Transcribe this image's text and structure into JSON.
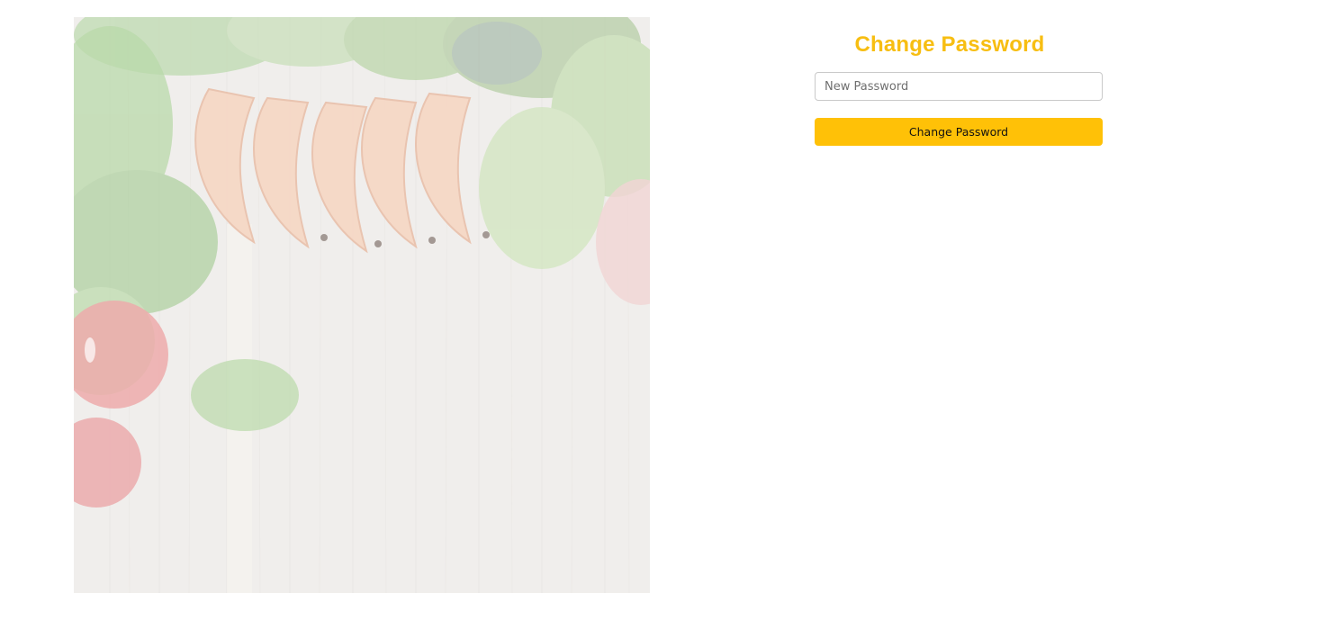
{
  "hero_image": {
    "icon": "food-background-image",
    "colors": {
      "wood": "#e9e7e4",
      "greens": "#9fc98f",
      "shrimp": "#f1c9b0",
      "tomato": "#e8878a"
    }
  },
  "form": {
    "title": "Change Password",
    "new_password": {
      "value": "",
      "placeholder": "New Password"
    },
    "submit_label": "Change Password"
  },
  "colors": {
    "accent": "#f7be12",
    "button": "#ffc107"
  }
}
